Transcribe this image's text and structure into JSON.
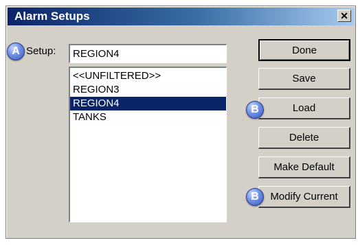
{
  "window": {
    "title": "Alarm Setups",
    "close_label": "✕"
  },
  "setup": {
    "badge": "A",
    "label": "Setup:",
    "value": "REGION4"
  },
  "list": {
    "items": [
      {
        "label": "<<UNFILTERED>>",
        "selected": false
      },
      {
        "label": "REGION3",
        "selected": false
      },
      {
        "label": "REGION4",
        "selected": true
      },
      {
        "label": "TANKS",
        "selected": false
      }
    ]
  },
  "buttons": {
    "done": "Done",
    "save": "Save",
    "load": "Load",
    "delete": "Delete",
    "make_default": "Make Default",
    "modify_current": "Modify Current"
  },
  "badges": {
    "load": "B",
    "modify_current": "B"
  },
  "colors": {
    "selection": "#0a246a",
    "badge": "#5b7fe0",
    "dialog": "#d4d0c8"
  }
}
